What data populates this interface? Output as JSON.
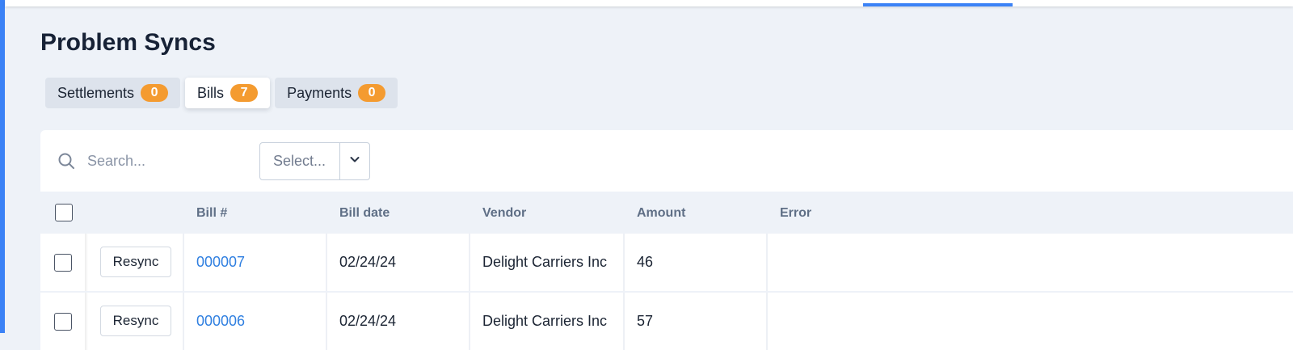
{
  "page_title": "Problem Syncs",
  "colors": {
    "accent": "#3b82f6",
    "badge": "#f49b30",
    "link": "#2f7fe0"
  },
  "tabs": [
    {
      "label": "Settlements",
      "count": "0",
      "active": false
    },
    {
      "label": "Bills",
      "count": "7",
      "active": true
    },
    {
      "label": "Payments",
      "count": "0",
      "active": false
    }
  ],
  "toolbar": {
    "search_placeholder": "Search...",
    "search_icon": "search-icon",
    "select_placeholder": "Select...",
    "select_icon": "chevron-down-icon"
  },
  "table": {
    "columns": [
      "Bill #",
      "Bill date",
      "Vendor",
      "Amount",
      "Error"
    ],
    "action_label": "Resync",
    "rows": [
      {
        "bill_number": "000007",
        "bill_date": "02/24/24",
        "vendor": "Delight Carriers Inc",
        "amount": "46",
        "error": ""
      },
      {
        "bill_number": "000006",
        "bill_date": "02/24/24",
        "vendor": "Delight Carriers Inc",
        "amount": "57",
        "error": ""
      }
    ]
  }
}
